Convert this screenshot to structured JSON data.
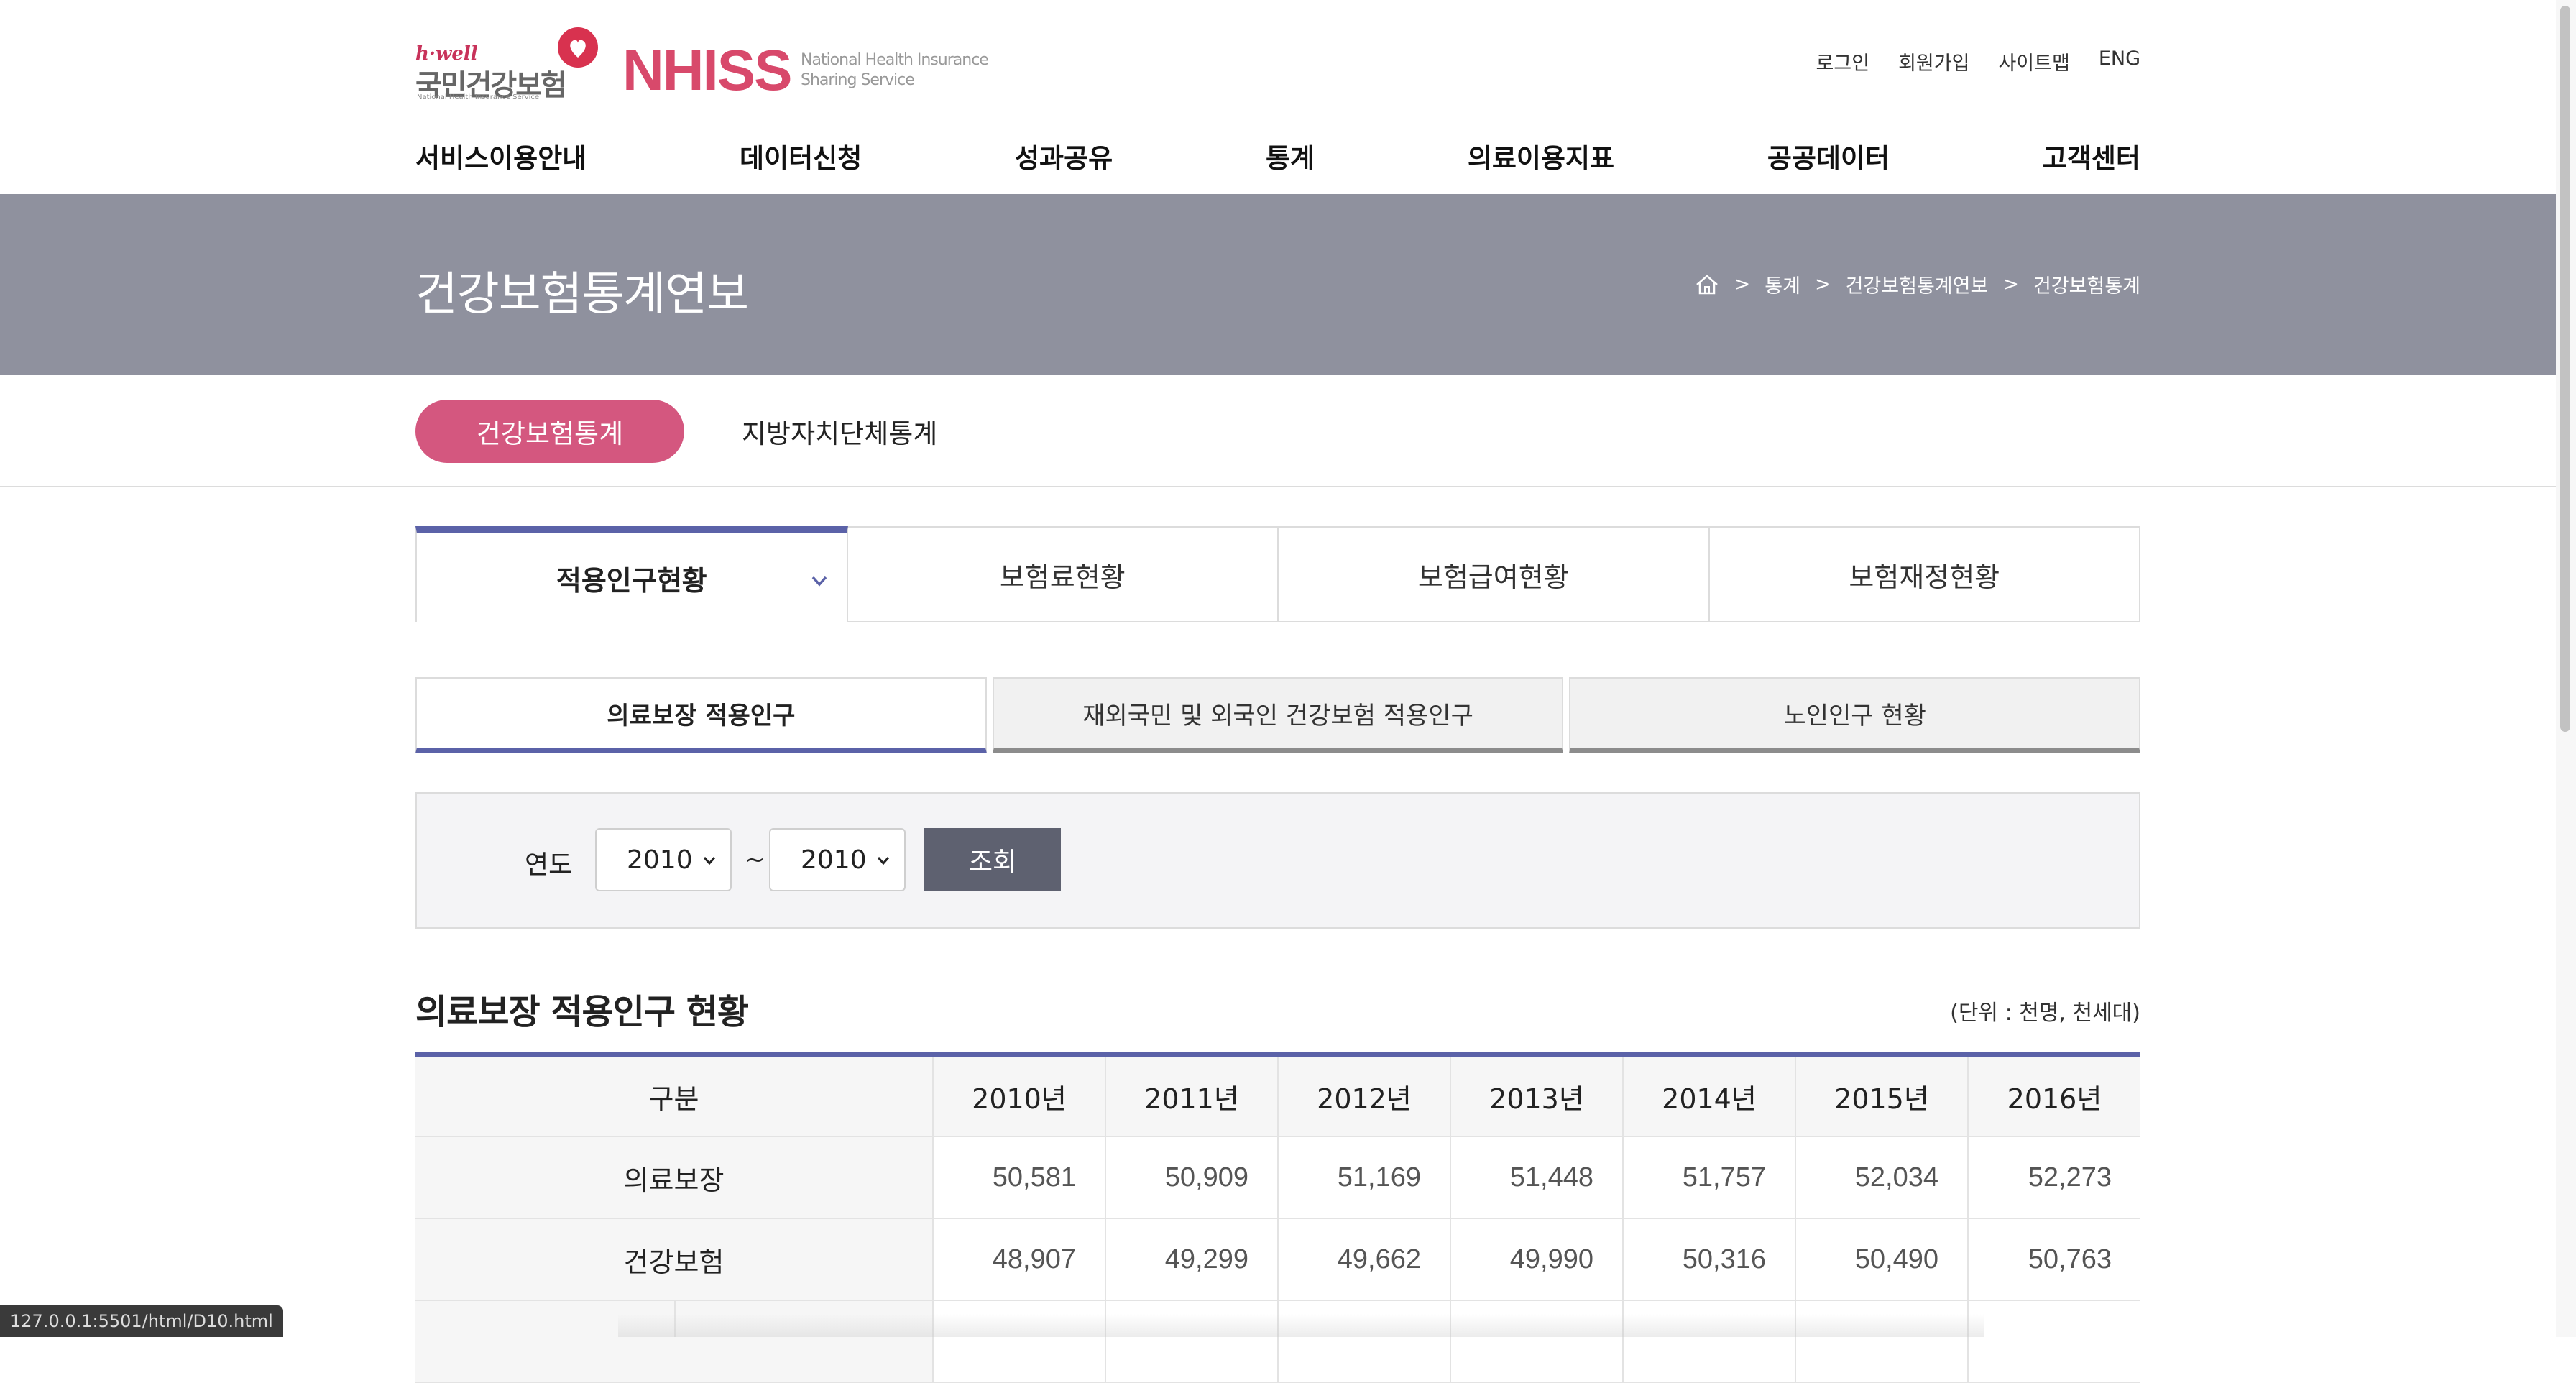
{
  "header": {
    "logo_hwell": "h·well",
    "logo_korean": "국민건강보험",
    "logo_small": "National Health Insurance Service",
    "logo_nhiss": "NHISS",
    "logo_nhiss_sub1": "National Health Insurance",
    "logo_nhiss_sub2": "Sharing Service",
    "util": [
      "로그인",
      "회원가입",
      "사이트맵",
      "ENG"
    ]
  },
  "gnb": [
    "서비스이용안내",
    "데이터신청",
    "성과공유",
    "통계",
    "의료이용지표",
    "공공데이터",
    "고객센터"
  ],
  "banner": {
    "title": "건강보험통계연보",
    "breadcrumb": [
      "통계",
      "건강보험통계연보",
      "건강보험통계"
    ]
  },
  "region_tabs": [
    "건강보험통계",
    "지방자치단체통계"
  ],
  "main_tabs": [
    "적용인구현황",
    "보험료현황",
    "보험급여현황",
    "보험재정현황"
  ],
  "sub_tabs": [
    "의료보장 적용인구",
    "재외국민 및 외국인 건강보험 적용인구",
    "노인인구 현황"
  ],
  "search": {
    "label": "연도",
    "from": "2010",
    "to": "2010",
    "separator": "~",
    "button": "조회"
  },
  "section": {
    "title": "의료보장 적용인구 현황",
    "unit": "(단위 : 천명, 천세대)"
  },
  "table": {
    "header_label": "구분",
    "years": [
      "2010년",
      "2011년",
      "2012년",
      "2013년",
      "2014년",
      "2015년",
      "2016년"
    ],
    "rows": [
      {
        "label": "의료보장",
        "values": [
          "50,581",
          "50,909",
          "51,169",
          "51,448",
          "51,757",
          "52,034",
          "52,273"
        ]
      },
      {
        "label": "건강보험",
        "values": [
          "48,907",
          "49,299",
          "49,662",
          "49,990",
          "50,316",
          "50,490",
          "50,763"
        ]
      }
    ]
  },
  "status_url": "127.0.0.1:5501/html/D10.html",
  "colors": {
    "accent_pink": "#d4577f",
    "accent_navy": "#5b62a8",
    "banner_gray": "#8f919e",
    "button_dark": "#5e6170"
  }
}
